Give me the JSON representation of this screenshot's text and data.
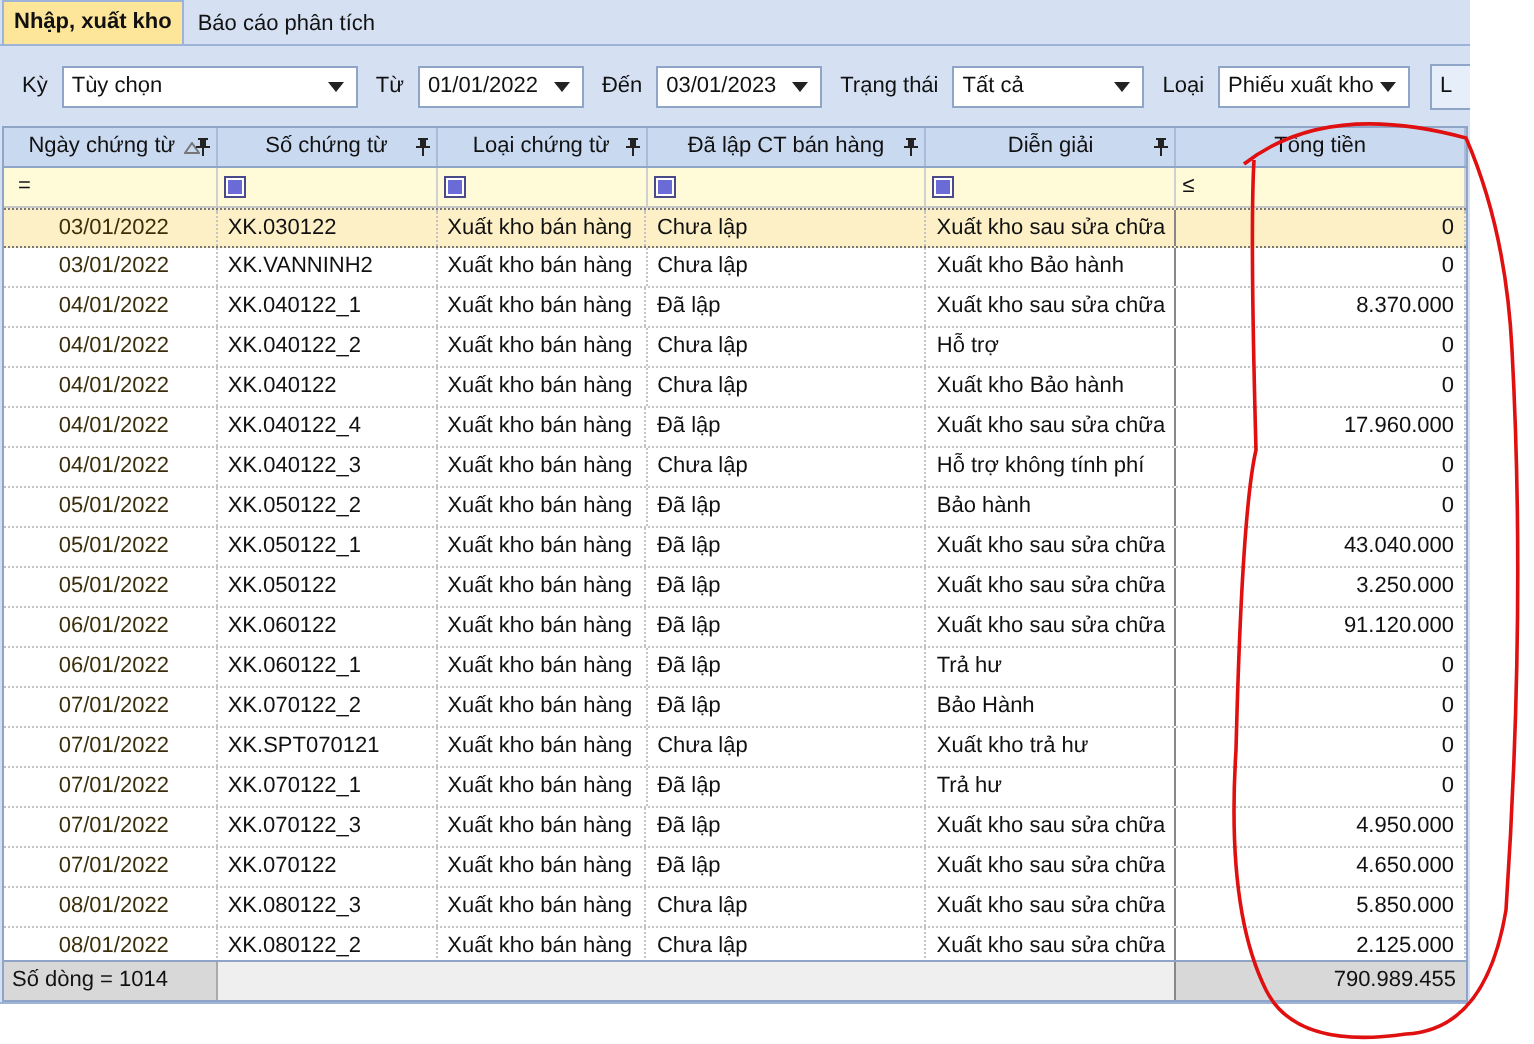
{
  "tabs": [
    {
      "label": "Nhập, xuất kho",
      "selected": true
    },
    {
      "label": "Báo cáo phân tích",
      "selected": false
    }
  ],
  "filters": [
    {
      "label": "Kỳ",
      "value": "Tùy chọn",
      "kind": "wide"
    },
    {
      "label": "Từ",
      "value": "01/01/2022",
      "kind": "date"
    },
    {
      "label": "Đến",
      "value": "03/01/2023",
      "kind": "date"
    },
    {
      "label": "Trạng thái",
      "value": "Tất cả",
      "kind": "mid"
    },
    {
      "label": "Loại",
      "value": "Phiếu xuất kho",
      "kind": "mid"
    }
  ],
  "toolbar_button": "L",
  "columns": [
    {
      "label": "Ngày chứng từ",
      "sorted": true,
      "pinned": true
    },
    {
      "label": "Số chứng từ",
      "sorted": false,
      "pinned": true
    },
    {
      "label": "Loại chứng từ",
      "sorted": false,
      "pinned": true
    },
    {
      "label": "Đã lập CT bán hàng",
      "sorted": false,
      "pinned": true
    },
    {
      "label": "Diễn giải",
      "sorted": false,
      "pinned": true
    },
    {
      "label": "Tổng tiền",
      "sorted": false,
      "pinned": false
    }
  ],
  "filter_row": [
    {
      "kind": "operator",
      "symbol": "="
    },
    {
      "kind": "checkbox"
    },
    {
      "kind": "checkbox"
    },
    {
      "kind": "checkbox"
    },
    {
      "kind": "checkbox"
    },
    {
      "kind": "operator",
      "symbol": "≤"
    }
  ],
  "rows": [
    {
      "selected": true,
      "cells": [
        "03/01/2022",
        "XK.030122",
        "Xuất kho bán hàng",
        "Chưa lập",
        "Xuất kho sau sửa chữa",
        "0"
      ]
    },
    {
      "selected": false,
      "cells": [
        "03/01/2022",
        "XK.VANNINH2",
        "Xuất kho bán hàng",
        "Chưa lập",
        "Xuất kho Bảo hành",
        "0"
      ]
    },
    {
      "selected": false,
      "cells": [
        "04/01/2022",
        "XK.040122_1",
        "Xuất kho bán hàng",
        "Đã lập",
        "Xuất kho sau sửa chữa",
        "8.370.000"
      ]
    },
    {
      "selected": false,
      "cells": [
        "04/01/2022",
        "XK.040122_2",
        "Xuất kho bán hàng",
        "Chưa lập",
        "Hỗ trợ",
        "0"
      ]
    },
    {
      "selected": false,
      "cells": [
        "04/01/2022",
        "XK.040122",
        "Xuất kho bán hàng",
        "Chưa lập",
        "Xuất kho Bảo hành",
        "0"
      ]
    },
    {
      "selected": false,
      "cells": [
        "04/01/2022",
        "XK.040122_4",
        "Xuất kho bán hàng",
        "Đã lập",
        "Xuất kho sau sửa chữa",
        "17.960.000"
      ]
    },
    {
      "selected": false,
      "cells": [
        "04/01/2022",
        "XK.040122_3",
        "Xuất kho bán hàng",
        "Chưa lập",
        "Hỗ trợ không tính phí",
        "0"
      ]
    },
    {
      "selected": false,
      "cells": [
        "05/01/2022",
        "XK.050122_2",
        "Xuất kho bán hàng",
        "Đã lập",
        "Bảo hành",
        "0"
      ]
    },
    {
      "selected": false,
      "cells": [
        "05/01/2022",
        "XK.050122_1",
        "Xuất kho bán hàng",
        "Đã lập",
        "Xuất kho sau sửa chữa",
        "43.040.000"
      ]
    },
    {
      "selected": false,
      "cells": [
        "05/01/2022",
        "XK.050122",
        "Xuất kho bán hàng",
        "Đã lập",
        "Xuất kho sau sửa chữa",
        "3.250.000"
      ]
    },
    {
      "selected": false,
      "cells": [
        "06/01/2022",
        "XK.060122",
        "Xuất kho bán hàng",
        "Đã lập",
        "Xuất kho sau sửa chữa",
        "91.120.000"
      ]
    },
    {
      "selected": false,
      "cells": [
        "06/01/2022",
        "XK.060122_1",
        "Xuất kho bán hàng",
        "Đã lập",
        "Trả hư",
        "0"
      ]
    },
    {
      "selected": false,
      "cells": [
        "07/01/2022",
        "XK.070122_2",
        "Xuất kho bán hàng",
        "Đã lập",
        "Bảo Hành",
        "0"
      ]
    },
    {
      "selected": false,
      "cells": [
        "07/01/2022",
        "XK.SPT070121",
        "Xuất kho bán hàng",
        "Chưa lập",
        "Xuất kho trả hư",
        "0"
      ]
    },
    {
      "selected": false,
      "cells": [
        "07/01/2022",
        "XK.070122_1",
        "Xuất kho bán hàng",
        "Đã lập",
        "Trả hư",
        "0"
      ]
    },
    {
      "selected": false,
      "cells": [
        "07/01/2022",
        "XK.070122_3",
        "Xuất kho bán hàng",
        "Đã lập",
        "Xuất kho sau sửa chữa",
        "4.950.000"
      ]
    },
    {
      "selected": false,
      "cells": [
        "07/01/2022",
        "XK.070122",
        "Xuất kho bán hàng",
        "Đã lập",
        "Xuất kho sau sửa chữa",
        "4.650.000"
      ]
    },
    {
      "selected": false,
      "cells": [
        "08/01/2022",
        "XK.080122_3",
        "Xuất kho bán hàng",
        "Chưa lập",
        "Xuất kho sau sửa chữa",
        "5.850.000"
      ]
    },
    {
      "selected": false,
      "cells": [
        "08/01/2022",
        "XK.080122_2",
        "Xuất kho bán hàng",
        "Chưa lập",
        "Xuất kho sau sửa chữa",
        "2.125.000"
      ]
    }
  ],
  "footer": {
    "count": "Số dòng = 1014",
    "total": "790.989.455"
  }
}
